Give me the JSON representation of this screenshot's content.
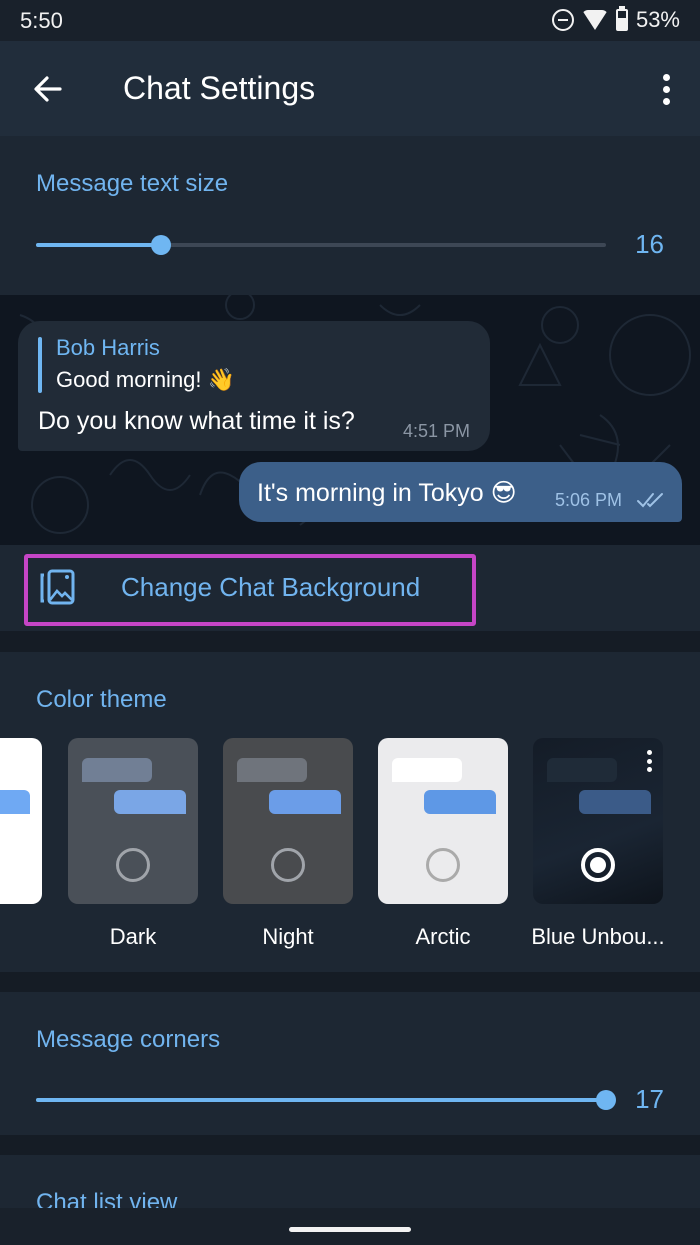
{
  "status_bar": {
    "time": "5:50",
    "battery_percent": "53%",
    "icons": [
      "do-not-disturb-icon",
      "wifi-icon",
      "battery-icon"
    ]
  },
  "app_bar": {
    "title": "Chat Settings",
    "back_icon": "arrow-left-icon",
    "menu_icon": "more-vertical-icon"
  },
  "text_size": {
    "title": "Message text size",
    "value": "16",
    "fraction": 0.22
  },
  "preview": {
    "incoming": {
      "reply_name": "Bob Harris",
      "reply_text": "Good morning! 👋",
      "text": "Do you know what time it is?",
      "time": "4:51 PM"
    },
    "outgoing": {
      "text": "It's morning in Tokyo 😎",
      "time": "5:06 PM",
      "status_icon": "double-check-icon"
    }
  },
  "change_background": {
    "label": "Change Chat Background",
    "icon": "wallpaper-icon"
  },
  "color_theme": {
    "title": "Color theme",
    "themes": [
      {
        "name": "",
        "selected": false
      },
      {
        "name": "Dark",
        "selected": false
      },
      {
        "name": "Night",
        "selected": false
      },
      {
        "name": "Arctic",
        "selected": false
      },
      {
        "name": "Blue Unbou...",
        "selected": true
      }
    ]
  },
  "message_corners": {
    "title": "Message corners",
    "value": "17",
    "fraction": 1.0
  },
  "chat_list_view": {
    "title": "Chat list view"
  },
  "colors": {
    "accent": "#71b4ef",
    "highlight": "#c545c6",
    "section_bg": "#1d2733",
    "appbar_bg": "#212d3b",
    "outgoing_bubble": "#3c5f89",
    "incoming_bubble": "#212b37"
  }
}
